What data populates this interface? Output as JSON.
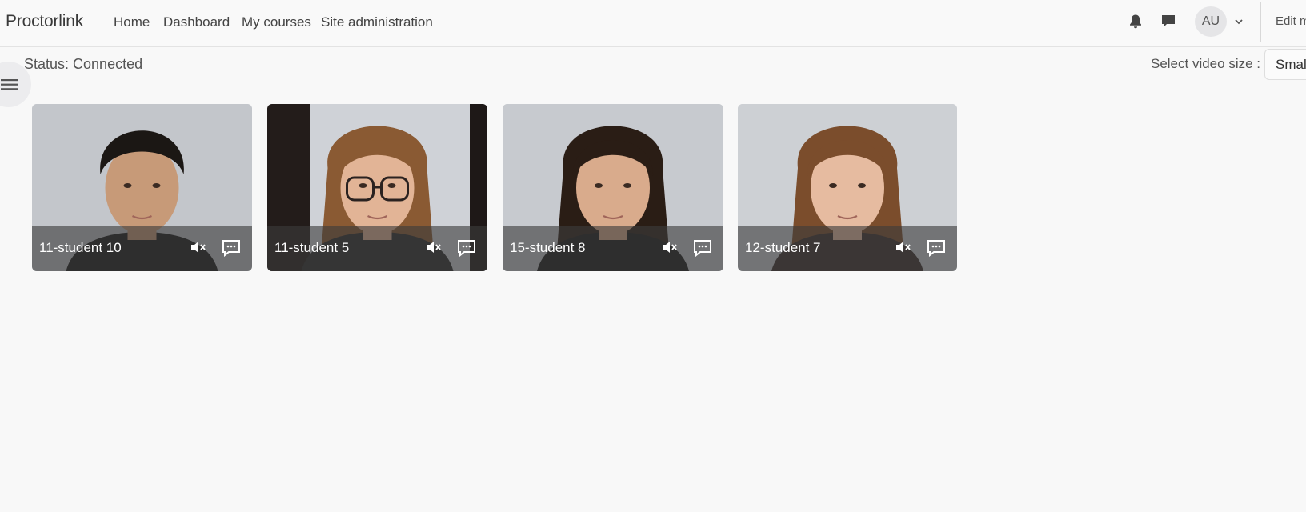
{
  "brand": "Proctorlink",
  "nav": {
    "links": [
      "Home",
      "Dashboard",
      "My courses",
      "Site administration"
    ],
    "avatar_initials": "AU",
    "edit_mode_label": "Edit mode"
  },
  "status_text": "Status: Connected",
  "video_size": {
    "label": "Select video size :",
    "selected": "Small"
  },
  "icons": {
    "notifications": "bell-icon",
    "messages": "message-icon",
    "user_menu": "chevron-down-icon",
    "drawer": "hamburger-menu-icon",
    "mute": "speaker-muted-icon",
    "chat": "chat-bubble-icon"
  },
  "students": [
    {
      "name": "11-student 10",
      "skin": "#c79a78",
      "hair": "#1b1714",
      "shirt": "#1a1a1a",
      "bg": "#c3c6cb"
    },
    {
      "name": "11-student 5",
      "skin": "#e2b496",
      "hair": "#8a5a33",
      "shirt": "#2a2a2a",
      "bg": "#cfd2d7",
      "glasses": true,
      "frame_dark": true
    },
    {
      "name": "15-student 8",
      "skin": "#d9ab8c",
      "hair": "#2a1d15",
      "shirt": "#1a1a1a",
      "bg": "#c7cacf"
    },
    {
      "name": "12-student 7",
      "skin": "#e6bba0",
      "hair": "#7b4d2c",
      "shirt": "#3b2f2a",
      "bg": "#cdd0d4"
    }
  ]
}
